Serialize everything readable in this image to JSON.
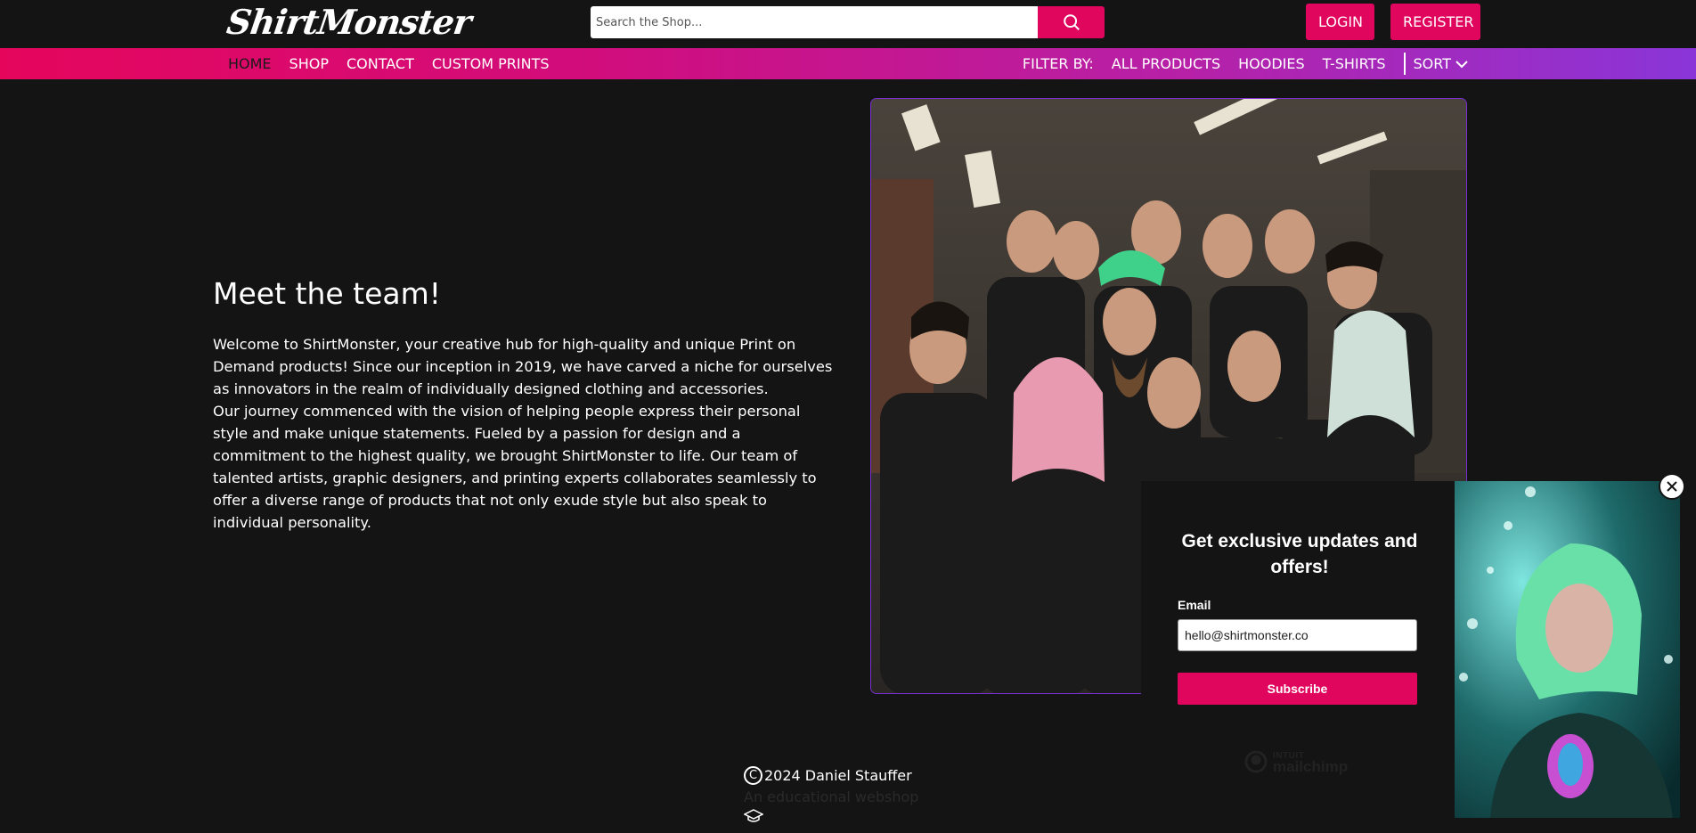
{
  "header": {
    "logo_text": "ShirtMonster",
    "search_placeholder": "Search the Shop...",
    "search_icon": "search-icon",
    "login_label": "LOGIN",
    "register_label": "REGISTER"
  },
  "nav": {
    "left": [
      {
        "label": "HOME",
        "active": true
      },
      {
        "label": "SHOP"
      },
      {
        "label": "CONTACT"
      },
      {
        "label": "CUSTOM PRINTS"
      }
    ],
    "filter_label": "FILTER BY:",
    "filters": [
      {
        "label": "ALL PRODUCTS"
      },
      {
        "label": "HOODIES"
      },
      {
        "label": "T-SHIRTS"
      }
    ],
    "sort_label": "SORT",
    "sort_icon": "chevron-down-icon"
  },
  "about": {
    "title": "Meet the team!",
    "paragraph_1": "Welcome to ShirtMonster, your creative hub for high-quality and unique Print on Demand products! Since our inception in 2019, we have carved a niche for ourselves as innovators in the realm of individually designed clothing and accessories.",
    "paragraph_2": "Our journey commenced with the vision of helping people express their personal style and make unique statements. Fueled by a passion for design and a commitment to the highest quality, we brought ShirtMonster to life. Our team of talented artists, graphic designers, and printing experts collaborates seamlessly to offer a diverse range of products that not only exude style but also speak to individual personality."
  },
  "footer": {
    "copyright_symbol": "C",
    "copyright_text": "2024 Daniel Stauffer",
    "tagline": "An educational webshop",
    "icon": "graduation-cap-icon"
  },
  "popup": {
    "title": "Get exclusive updates and offers!",
    "email_label": "Email",
    "email_value": "hello@shirtmonster.co",
    "submit_label": "Subscribe",
    "brand_line_1": "INTUIT",
    "brand_line_2": "mailchimp",
    "close_icon": "close-icon"
  },
  "colors": {
    "accent": "#e0065e",
    "nav_gradient_start": "#e5065c",
    "nav_gradient_end": "#8a35d8",
    "background": "#141414"
  }
}
